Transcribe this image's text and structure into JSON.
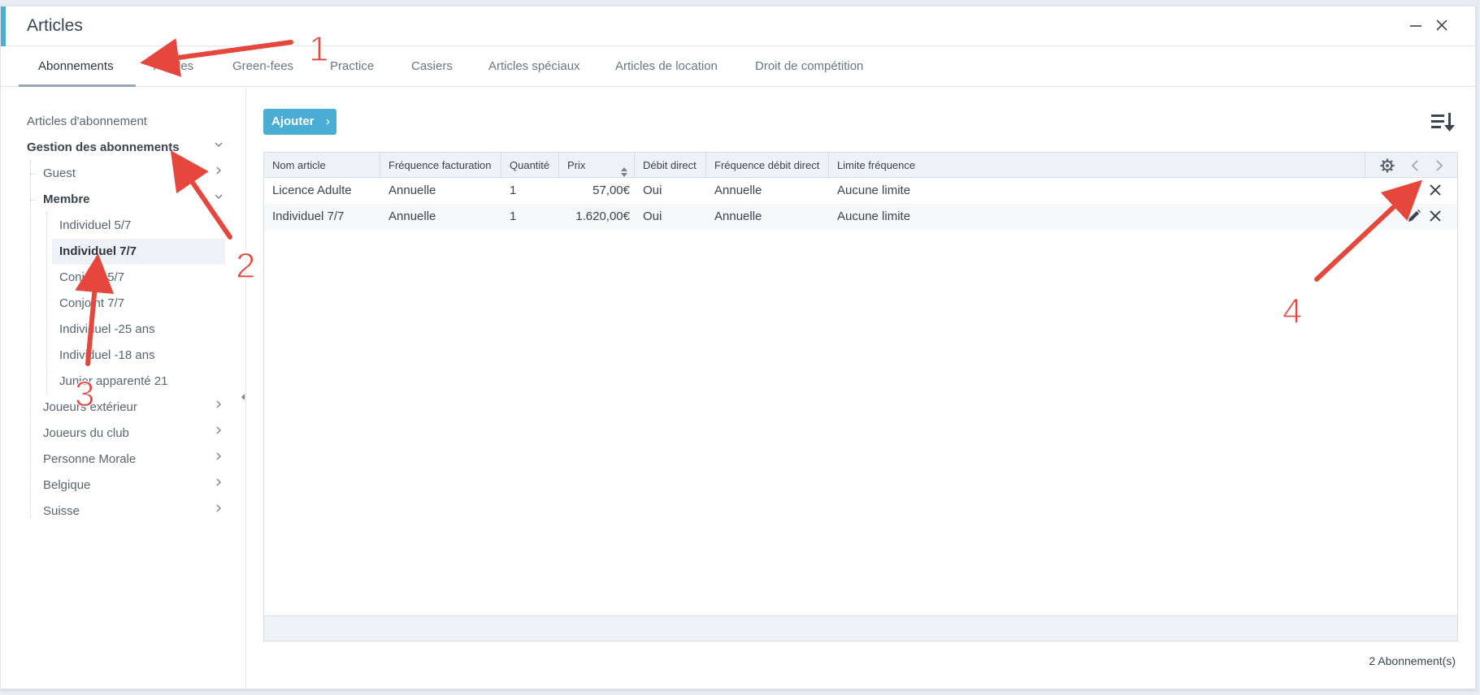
{
  "window": {
    "title": "Articles",
    "minimize_icon": "minimize-icon",
    "close_icon": "close-icon"
  },
  "tabs": [
    {
      "label": "Abonnements",
      "active": true
    },
    {
      "label": "Articles",
      "active": false
    },
    {
      "label": "Green-fees",
      "active": false
    },
    {
      "label": "Practice",
      "active": false
    },
    {
      "label": "Casiers",
      "active": false
    },
    {
      "label": "Articles spéciaux",
      "active": false
    },
    {
      "label": "Articles de location",
      "active": false
    },
    {
      "label": "Droit de compétition",
      "active": false
    }
  ],
  "sidebar": {
    "root": "Articles d'abonnement",
    "group": "Gestion des abonnements",
    "items": {
      "guest": "Guest",
      "membre": "Membre",
      "membre_children": [
        "Individuel 5/7",
        "Individuel 7/7",
        "Conjoint 5/7",
        "Conjoint 7/7",
        "Individuel -25 ans",
        "Individuel -18 ans",
        "Junior apparenté 21"
      ],
      "others": [
        "Joueurs extérieur",
        "Joueurs du club",
        "Personne Morale",
        "Belgique",
        "Suisse"
      ]
    },
    "selected": "Individuel 7/7"
  },
  "toolbar": {
    "add_label": "Ajouter",
    "add_arrow": "›",
    "sort_icon": "sort-list-icon"
  },
  "grid": {
    "columns": [
      "Nom article",
      "Fréquence facturation",
      "Quantité",
      "Prix",
      "Débit direct",
      "Fréquence débit direct",
      "Limite fréquence"
    ],
    "rows": [
      [
        "Licence Adulte",
        "Annuelle",
        "1",
        "57,00€",
        "Oui",
        "Annuelle",
        "Aucune limite"
      ],
      [
        "Individuel 7/7",
        "Annuelle",
        "1",
        "1.620,00€",
        "Oui",
        "Annuelle",
        "Aucune limite"
      ]
    ],
    "header_tools": [
      "gear-icon",
      "chevron-left-icon",
      "chevron-right-icon"
    ],
    "row_actions": [
      "pencil-icon",
      "delete-x-icon"
    ]
  },
  "footer": {
    "count": "2 Abonnement(s)"
  },
  "annotations": {
    "labels": [
      "1",
      "2",
      "3",
      "4"
    ],
    "color": "#e6473c"
  },
  "colors": {
    "accent": "#4aaed4",
    "selected_bg": "#eef1f5"
  }
}
